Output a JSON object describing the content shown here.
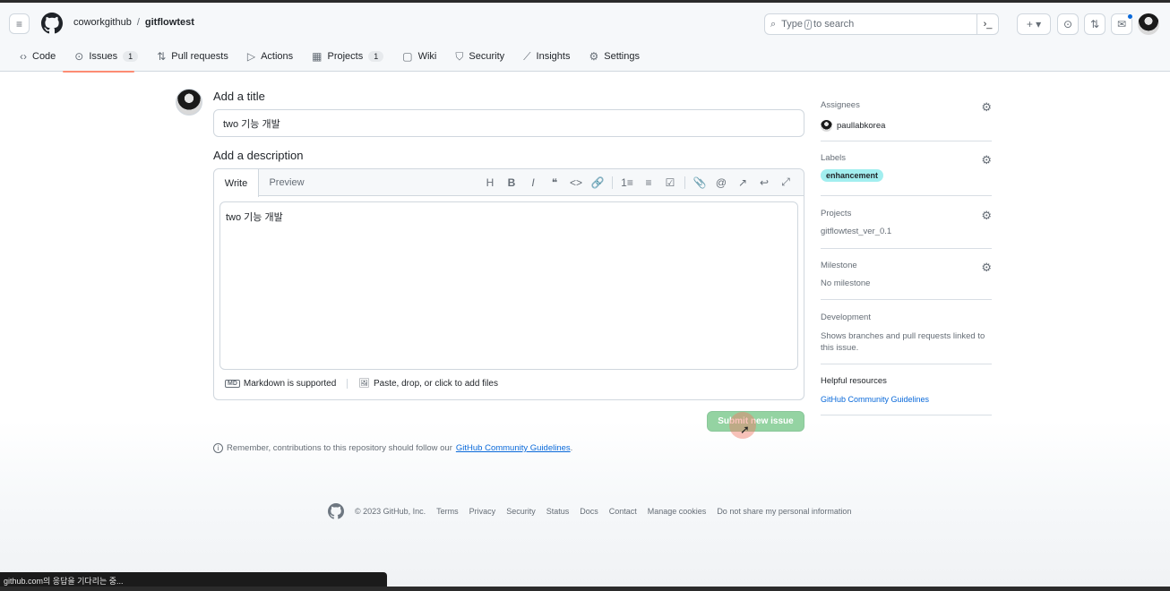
{
  "header": {
    "owner": "coworkgithub",
    "separator": "/",
    "repo": "gitflowtest",
    "search_prefix": "Type",
    "search_key": "/",
    "search_suffix": "to search",
    "command_glyph": "›_",
    "plus_glyph": "+ ▾"
  },
  "nav": {
    "tabs": [
      {
        "label": "Code",
        "icon": "code-icon",
        "glyph": "‹›"
      },
      {
        "label": "Issues",
        "icon": "issue-icon",
        "glyph": "⊙",
        "count": "1"
      },
      {
        "label": "Pull requests",
        "icon": "pull-request-icon",
        "glyph": "⇅"
      },
      {
        "label": "Actions",
        "icon": "play-icon",
        "glyph": "▷"
      },
      {
        "label": "Projects",
        "icon": "table-icon",
        "glyph": "▦",
        "count": "1"
      },
      {
        "label": "Wiki",
        "icon": "book-icon",
        "glyph": "▢"
      },
      {
        "label": "Security",
        "icon": "shield-icon",
        "glyph": "⛉"
      },
      {
        "label": "Insights",
        "icon": "graph-icon",
        "glyph": "⟋"
      },
      {
        "label": "Settings",
        "icon": "gear-icon",
        "glyph": "⚙"
      }
    ],
    "active_tab": "Issues"
  },
  "form": {
    "title_label": "Add a title",
    "title_value": "two 기능 개발",
    "description_label": "Add a description",
    "write_tab": "Write",
    "preview_tab": "Preview",
    "description_value": "two 기능 개발",
    "markdown_note": "Markdown is supported",
    "markdown_badge": "MD",
    "attach_note": "Paste, drop, or click to add files",
    "submit_label": "Submit new issue",
    "remember_text": "Remember, contributions to this repository should follow our",
    "remember_link": "GitHub Community Guidelines",
    "remember_end": "."
  },
  "toolbar": {
    "tools": [
      "H",
      "B",
      "I",
      "❝",
      "<>",
      "🔗",
      "1≡",
      "≡",
      "☑",
      "📎",
      "@",
      "↗",
      "↩",
      "⤢"
    ]
  },
  "sidebar": {
    "assignees_title": "Assignees",
    "assignee": "paullabkorea",
    "labels_title": "Labels",
    "label": "enhancement",
    "label_color": "#a2eeef",
    "projects_title": "Projects",
    "project": "gitflowtest_ver_0.1",
    "milestone_title": "Milestone",
    "milestone": "No milestone",
    "development_title": "Development",
    "development_text": "Shows branches and pull requests linked to this issue.",
    "helpful_title": "Helpful resources",
    "helpful_link": "GitHub Community Guidelines"
  },
  "footer": {
    "copyright": "© 2023 GitHub, Inc.",
    "links": [
      "Terms",
      "Privacy",
      "Security",
      "Status",
      "Docs",
      "Contact",
      "Manage cookies",
      "Do not share my personal information"
    ]
  },
  "status_bar": "github.com의 응답을 기다리는 중...",
  "colors": {
    "accent": "#0969da",
    "submit_disabled": "#94d3a2",
    "tab_underline": "#fd8c73"
  }
}
